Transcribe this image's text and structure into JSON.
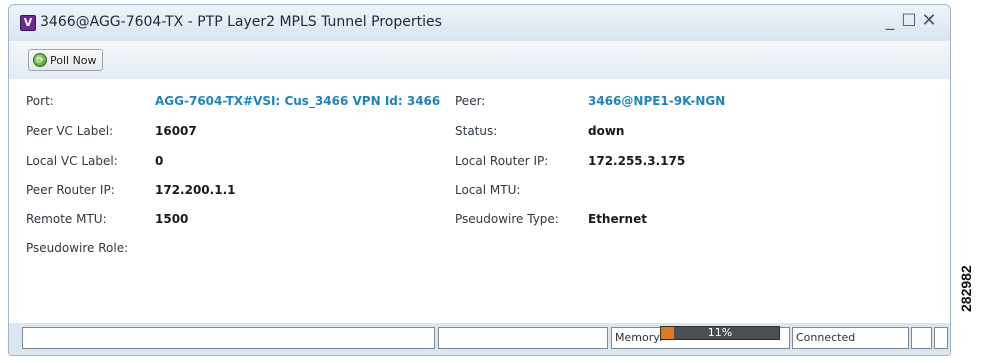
{
  "window": {
    "title": "3466@AGG-7604-TX - PTP Layer2 MPLS Tunnel Properties",
    "app_icon_letter": "V",
    "app_icon_color": "#6a2c8f",
    "controls": {
      "minimize": "_",
      "maximize": "☐",
      "close": "✕"
    }
  },
  "toolbar": {
    "poll_now": "Poll Now"
  },
  "properties": {
    "port_label": "Port:",
    "port_value": "AGG-7604-TX#VSI: Cus_3466 VPN Id: 3466",
    "peer_vc_label": "Peer VC Label:",
    "peer_vc_value": "16007",
    "local_vc_label": "Local VC Label:",
    "local_vc_value": "0",
    "peer_router_ip_label": "Peer Router IP:",
    "peer_router_ip_value": "172.200.1.1",
    "remote_mtu_label": "Remote MTU:",
    "remote_mtu_value": "1500",
    "pseudowire_role_label": "Pseudowire Role:",
    "peer_label": "Peer:",
    "peer_value": "3466@NPE1-9K-NGN",
    "status_label": "Status:",
    "status_value": "down",
    "local_router_ip_label": "Local Router IP:",
    "local_router_ip_value": "172.255.3.175",
    "local_mtu_label": "Local MTU:",
    "pseudowire_type_label": "Pseudowire Type:",
    "pseudowire_type_value": "Ethernet"
  },
  "status_bar": {
    "memory_label": "Memory:",
    "memory_percent": "11%",
    "memory_fraction": 0.11,
    "connection": "Connected"
  },
  "figure_code": "282982",
  "colors": {
    "link": "#1f84bb",
    "memory_fill": "#e2781e",
    "memory_bar": "#4a4f55"
  }
}
